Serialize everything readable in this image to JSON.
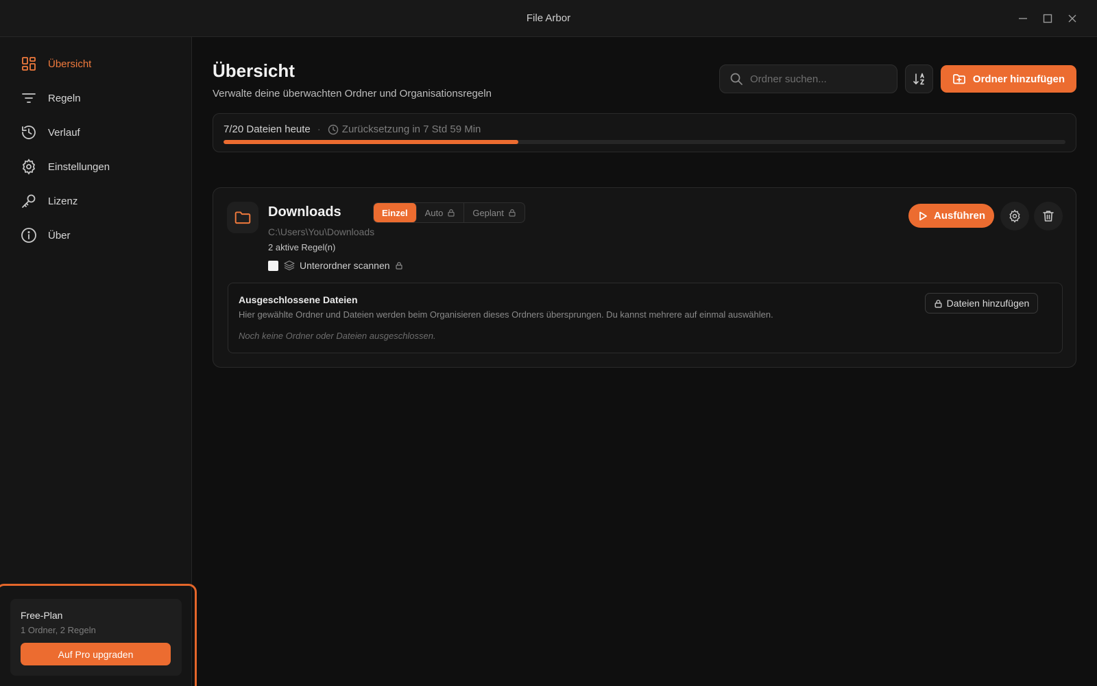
{
  "window": {
    "title": "File Arbor"
  },
  "sidebar": {
    "items": [
      {
        "label": "Übersicht",
        "icon": "grid-icon",
        "active": true
      },
      {
        "label": "Regeln",
        "icon": "filter-icon",
        "active": false
      },
      {
        "label": "Verlauf",
        "icon": "history-icon",
        "active": false
      },
      {
        "label": "Einstellungen",
        "icon": "gear-icon",
        "active": false
      },
      {
        "label": "Lizenz",
        "icon": "key-icon",
        "active": false
      },
      {
        "label": "Über",
        "icon": "info-icon",
        "active": false
      }
    ],
    "plan": {
      "name": "Free-Plan",
      "limits": "1 Ordner, 2 Regeln",
      "upgrade_label": "Auf Pro upgraden"
    }
  },
  "header": {
    "title": "Übersicht",
    "subtitle": "Verwalte deine überwachten Ordner und Organisationsregeln",
    "search_placeholder": "Ordner suchen...",
    "add_folder_label": "Ordner hinzufügen"
  },
  "quota": {
    "count_label": "7/20 Dateien heute",
    "separator": "·",
    "reset_label": "Zurücksetzung in 7 Std 59 Min",
    "progress_fraction": 0.35
  },
  "folders": [
    {
      "name": "Downloads",
      "path": "C:\\Users\\You\\Downloads",
      "rules_label": "2 aktive Regel(n)",
      "modes": [
        {
          "label": "Einzel",
          "active": true,
          "locked": false
        },
        {
          "label": "Auto",
          "active": false,
          "locked": true
        },
        {
          "label": "Geplant",
          "active": false,
          "locked": true
        }
      ],
      "subfolders_label": "Unterordner scannen",
      "subfolders_checked": false,
      "run_label": "Ausführen",
      "excluded": {
        "title": "Ausgeschlossene Dateien",
        "description": "Hier gewählte Ordner und Dateien werden beim Organisieren dieses Ordners übersprungen. Du kannst mehrere auf einmal auswählen.",
        "empty_text": "Noch keine Ordner oder Dateien ausgeschlossen.",
        "add_label": "Dateien hinzufügen"
      }
    }
  ],
  "colors": {
    "accent": "#ec6c30",
    "background": "#0f0f0f",
    "sidebar": "#151515"
  }
}
